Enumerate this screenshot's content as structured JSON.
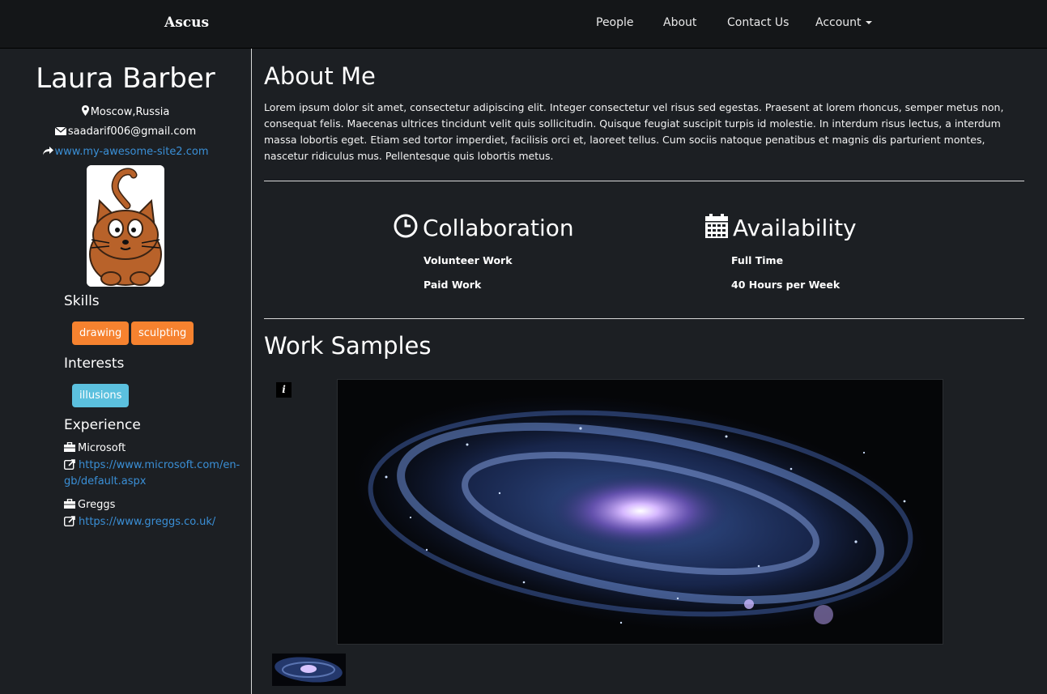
{
  "navbar": {
    "brand": "Ascus",
    "items": [
      "People",
      "About",
      "Contact Us",
      "Account"
    ]
  },
  "profile": {
    "name": "Laura Barber",
    "location": "Moscow,Russia",
    "email": "saadarif006@gmail.com",
    "website": "www.my-awesome-site2.com"
  },
  "skills": {
    "title": "Skills",
    "items": [
      "drawing",
      "sculpting"
    ]
  },
  "interests": {
    "title": "Interests",
    "items": [
      "illusions"
    ]
  },
  "experience": {
    "title": "Experience",
    "items": [
      {
        "company": "Microsoft",
        "url": "https://www.microsoft.com/en-gb/default.aspx"
      },
      {
        "company": "Greggs",
        "url": "https://www.greggs.co.uk/"
      }
    ]
  },
  "about": {
    "title": "About Me",
    "text": "Lorem ipsum dolor sit amet, consectetur adipiscing elit. Integer consectetur vel risus sed egestas. Praesent at lorem rhoncus, semper metus non, consequat felis. Maecenas ultrices tincidunt velit quis sollicitudin. Quisque feugiat suscipit turpis id molestie. In interdum risus lectus, a interdum massa lobortis eget. Etiam sed tortor imperdiet, facilisis orci et, laoreet tellus. Cum sociis natoque penatibus et magnis dis parturient montes, nascetur ridiculus mus. Pellentesque quis lobortis metus."
  },
  "collaboration": {
    "title": "Collaboration",
    "items": [
      "Volunteer Work",
      "Paid Work"
    ]
  },
  "availability": {
    "title": "Availability",
    "items": [
      "Full Time",
      "40 Hours per Week"
    ]
  },
  "work_samples": {
    "title": "Work Samples",
    "info_label": "i"
  },
  "colors": {
    "background": "#1c1f23",
    "navbar": "#141618",
    "link": "#3a8fd6",
    "skill_tag": "#f6822f",
    "interest_tag": "#5bc0de"
  },
  "icons": [
    "map-marker-icon",
    "envelope-icon",
    "share-arrow-icon",
    "briefcase-icon",
    "external-link-icon",
    "clock-icon",
    "calendar-icon",
    "caret-down-icon",
    "info-icon"
  ]
}
